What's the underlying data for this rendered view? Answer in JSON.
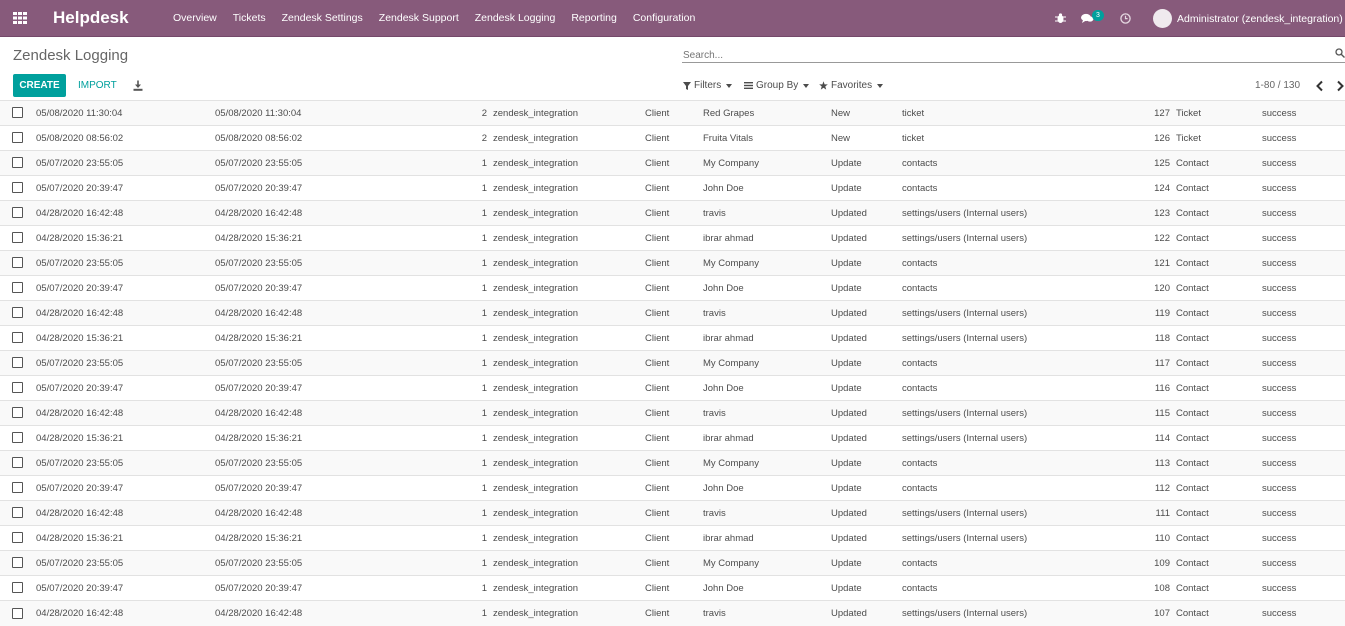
{
  "navbar": {
    "brand": "Helpdesk",
    "menu": [
      "Overview",
      "Tickets",
      "Zendesk Settings",
      "Zendesk Support",
      "Zendesk Logging",
      "Reporting",
      "Configuration"
    ],
    "message_count": "3",
    "user": "Administrator (zendesk_integration)",
    "colors": {
      "bar": "#875a7b",
      "accent": "#00a09d"
    }
  },
  "page": {
    "title": "Zendesk Logging"
  },
  "search": {
    "placeholder": "Search..."
  },
  "toolbar": {
    "create": "CREATE",
    "import": "IMPORT"
  },
  "filters": {
    "filters": "Filters",
    "group_by": "Group By",
    "favorites": "Favorites"
  },
  "pager": {
    "range": "1-80 / 130"
  },
  "rows": [
    {
      "date1": "05/08/2020 11:30:04",
      "date2": "05/08/2020 11:30:04",
      "count": "2",
      "user": "zendesk_integration",
      "side": "Client",
      "name": "Red Grapes",
      "action": "New",
      "model": "ticket",
      "id": "127",
      "type": "Ticket",
      "status": "success"
    },
    {
      "date1": "05/08/2020 08:56:02",
      "date2": "05/08/2020 08:56:02",
      "count": "2",
      "user": "zendesk_integration",
      "side": "Client",
      "name": "Fruita Vitals",
      "action": "New",
      "model": "ticket",
      "id": "126",
      "type": "Ticket",
      "status": "success"
    },
    {
      "date1": "05/07/2020 23:55:05",
      "date2": "05/07/2020 23:55:05",
      "count": "1",
      "user": "zendesk_integration",
      "side": "Client",
      "name": "My Company",
      "action": "Update",
      "model": "contacts",
      "id": "125",
      "type": "Contact",
      "status": "success"
    },
    {
      "date1": "05/07/2020 20:39:47",
      "date2": "05/07/2020 20:39:47",
      "count": "1",
      "user": "zendesk_integration",
      "side": "Client",
      "name": "John Doe",
      "action": "Update",
      "model": "contacts",
      "id": "124",
      "type": "Contact",
      "status": "success"
    },
    {
      "date1": "04/28/2020 16:42:48",
      "date2": "04/28/2020 16:42:48",
      "count": "1",
      "user": "zendesk_integration",
      "side": "Client",
      "name": "travis",
      "action": "Updated",
      "model": "settings/users (Internal users)",
      "id": "123",
      "type": "Contact",
      "status": "success"
    },
    {
      "date1": "04/28/2020 15:36:21",
      "date2": "04/28/2020 15:36:21",
      "count": "1",
      "user": "zendesk_integration",
      "side": "Client",
      "name": "ibrar ahmad",
      "action": "Updated",
      "model": "settings/users (Internal users)",
      "id": "122",
      "type": "Contact",
      "status": "success"
    },
    {
      "date1": "05/07/2020 23:55:05",
      "date2": "05/07/2020 23:55:05",
      "count": "1",
      "user": "zendesk_integration",
      "side": "Client",
      "name": "My Company",
      "action": "Update",
      "model": "contacts",
      "id": "121",
      "type": "Contact",
      "status": "success"
    },
    {
      "date1": "05/07/2020 20:39:47",
      "date2": "05/07/2020 20:39:47",
      "count": "1",
      "user": "zendesk_integration",
      "side": "Client",
      "name": "John Doe",
      "action": "Update",
      "model": "contacts",
      "id": "120",
      "type": "Contact",
      "status": "success"
    },
    {
      "date1": "04/28/2020 16:42:48",
      "date2": "04/28/2020 16:42:48",
      "count": "1",
      "user": "zendesk_integration",
      "side": "Client",
      "name": "travis",
      "action": "Updated",
      "model": "settings/users (Internal users)",
      "id": "119",
      "type": "Contact",
      "status": "success"
    },
    {
      "date1": "04/28/2020 15:36:21",
      "date2": "04/28/2020 15:36:21",
      "count": "1",
      "user": "zendesk_integration",
      "side": "Client",
      "name": "ibrar ahmad",
      "action": "Updated",
      "model": "settings/users (Internal users)",
      "id": "118",
      "type": "Contact",
      "status": "success"
    },
    {
      "date1": "05/07/2020 23:55:05",
      "date2": "05/07/2020 23:55:05",
      "count": "1",
      "user": "zendesk_integration",
      "side": "Client",
      "name": "My Company",
      "action": "Update",
      "model": "contacts",
      "id": "117",
      "type": "Contact",
      "status": "success"
    },
    {
      "date1": "05/07/2020 20:39:47",
      "date2": "05/07/2020 20:39:47",
      "count": "1",
      "user": "zendesk_integration",
      "side": "Client",
      "name": "John Doe",
      "action": "Update",
      "model": "contacts",
      "id": "116",
      "type": "Contact",
      "status": "success"
    },
    {
      "date1": "04/28/2020 16:42:48",
      "date2": "04/28/2020 16:42:48",
      "count": "1",
      "user": "zendesk_integration",
      "side": "Client",
      "name": "travis",
      "action": "Updated",
      "model": "settings/users (Internal users)",
      "id": "115",
      "type": "Contact",
      "status": "success"
    },
    {
      "date1": "04/28/2020 15:36:21",
      "date2": "04/28/2020 15:36:21",
      "count": "1",
      "user": "zendesk_integration",
      "side": "Client",
      "name": "ibrar ahmad",
      "action": "Updated",
      "model": "settings/users (Internal users)",
      "id": "114",
      "type": "Contact",
      "status": "success"
    },
    {
      "date1": "05/07/2020 23:55:05",
      "date2": "05/07/2020 23:55:05",
      "count": "1",
      "user": "zendesk_integration",
      "side": "Client",
      "name": "My Company",
      "action": "Update",
      "model": "contacts",
      "id": "113",
      "type": "Contact",
      "status": "success"
    },
    {
      "date1": "05/07/2020 20:39:47",
      "date2": "05/07/2020 20:39:47",
      "count": "1",
      "user": "zendesk_integration",
      "side": "Client",
      "name": "John Doe",
      "action": "Update",
      "model": "contacts",
      "id": "112",
      "type": "Contact",
      "status": "success"
    },
    {
      "date1": "04/28/2020 16:42:48",
      "date2": "04/28/2020 16:42:48",
      "count": "1",
      "user": "zendesk_integration",
      "side": "Client",
      "name": "travis",
      "action": "Updated",
      "model": "settings/users (Internal users)",
      "id": "111",
      "type": "Contact",
      "status": "success"
    },
    {
      "date1": "04/28/2020 15:36:21",
      "date2": "04/28/2020 15:36:21",
      "count": "1",
      "user": "zendesk_integration",
      "side": "Client",
      "name": "ibrar ahmad",
      "action": "Updated",
      "model": "settings/users (Internal users)",
      "id": "110",
      "type": "Contact",
      "status": "success"
    },
    {
      "date1": "05/07/2020 23:55:05",
      "date2": "05/07/2020 23:55:05",
      "count": "1",
      "user": "zendesk_integration",
      "side": "Client",
      "name": "My Company",
      "action": "Update",
      "model": "contacts",
      "id": "109",
      "type": "Contact",
      "status": "success"
    },
    {
      "date1": "05/07/2020 20:39:47",
      "date2": "05/07/2020 20:39:47",
      "count": "1",
      "user": "zendesk_integration",
      "side": "Client",
      "name": "John Doe",
      "action": "Update",
      "model": "contacts",
      "id": "108",
      "type": "Contact",
      "status": "success"
    },
    {
      "date1": "04/28/2020 16:42:48",
      "date2": "04/28/2020 16:42:48",
      "count": "1",
      "user": "zendesk_integration",
      "side": "Client",
      "name": "travis",
      "action": "Updated",
      "model": "settings/users (Internal users)",
      "id": "107",
      "type": "Contact",
      "status": "success"
    }
  ]
}
